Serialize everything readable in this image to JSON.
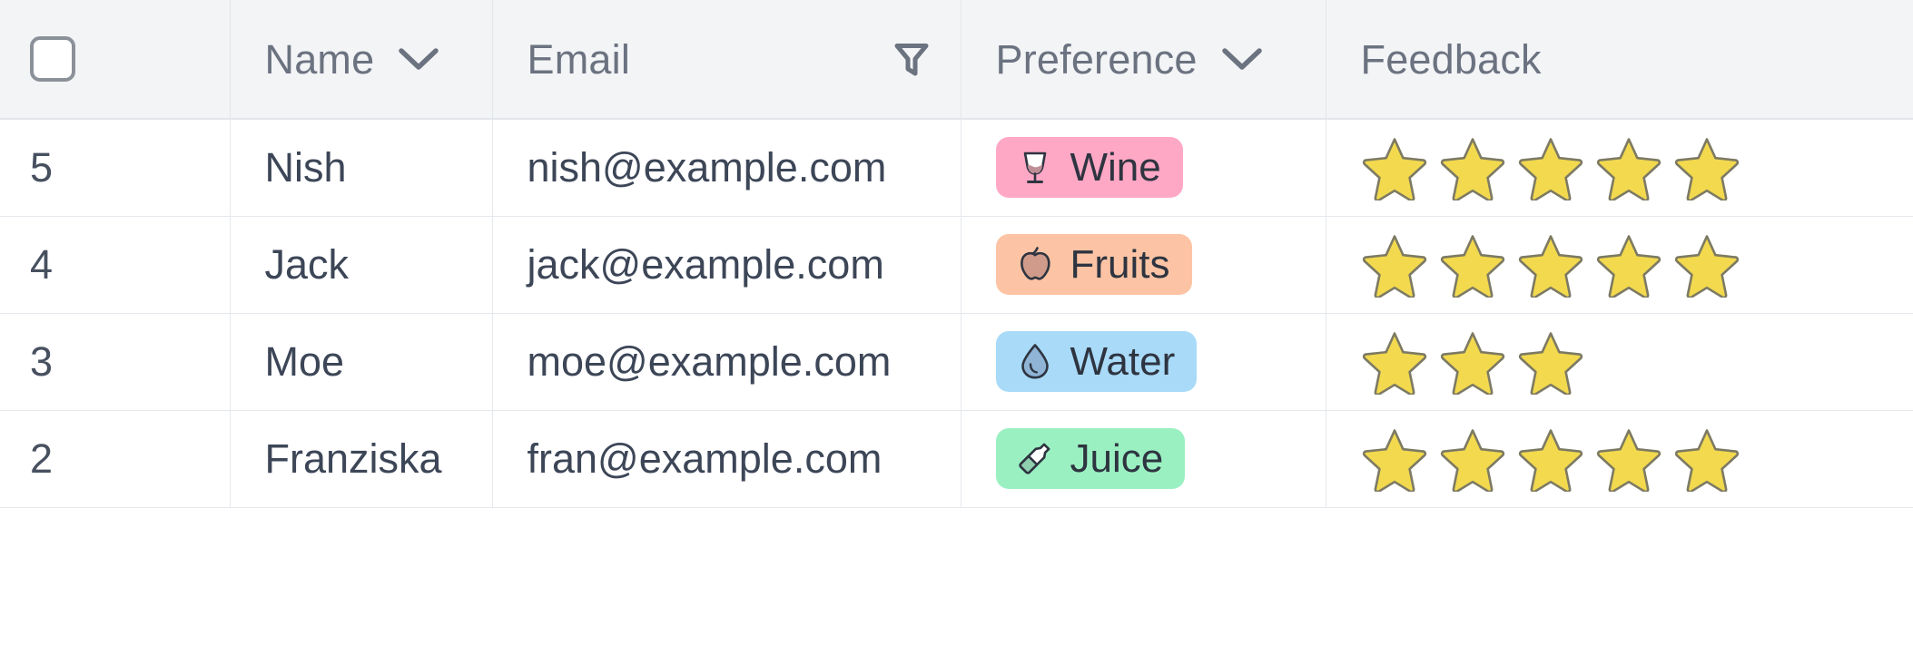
{
  "table": {
    "columns": [
      {
        "key": "select",
        "label": "",
        "icon": "checkbox",
        "sortable": false,
        "filterable": false
      },
      {
        "key": "name",
        "label": "Name",
        "icon": "chevron-down",
        "sortable": true,
        "filterable": false
      },
      {
        "key": "email",
        "label": "Email",
        "icon": "filter",
        "sortable": false,
        "filterable": true
      },
      {
        "key": "preference",
        "label": "Preference",
        "icon": "chevron-down",
        "sortable": true,
        "filterable": false
      },
      {
        "key": "feedback",
        "label": "Feedback",
        "icon": "",
        "sortable": false,
        "filterable": false
      }
    ],
    "rows": [
      {
        "rownum": "5",
        "name": "Nish",
        "email": "nish@example.com",
        "preference": {
          "label": "Wine",
          "icon": "wine-glass",
          "bg": "#ffa8c5",
          "fg": "#2e3440"
        },
        "feedback": {
          "rating": 5,
          "max": 5
        }
      },
      {
        "rownum": "4",
        "name": "Jack",
        "email": "jack@example.com",
        "preference": {
          "label": "Fruits",
          "icon": "apple",
          "bg": "#fcc4a4",
          "fg": "#2e3440"
        },
        "feedback": {
          "rating": 5,
          "max": 5
        }
      },
      {
        "rownum": "3",
        "name": "Moe",
        "email": "moe@example.com",
        "preference": {
          "label": "Water",
          "icon": "water-drop",
          "bg": "#a9daf8",
          "fg": "#2e3440"
        },
        "feedback": {
          "rating": 3,
          "max": 5
        }
      },
      {
        "rownum": "2",
        "name": "Franziska",
        "email": "fran@example.com",
        "preference": {
          "label": "Juice",
          "icon": "juice-bottle",
          "bg": "#9bf0c2",
          "fg": "#2e3440"
        },
        "feedback": {
          "rating": 5,
          "max": 5
        }
      }
    ],
    "colors": {
      "header_bg": "#f3f4f6",
      "header_text": "#6b7280",
      "body_text": "#3c4657",
      "grid_line": "#e5e8ec",
      "star_fill": "#f2d94e",
      "star_stroke": "#7d7a63"
    }
  }
}
